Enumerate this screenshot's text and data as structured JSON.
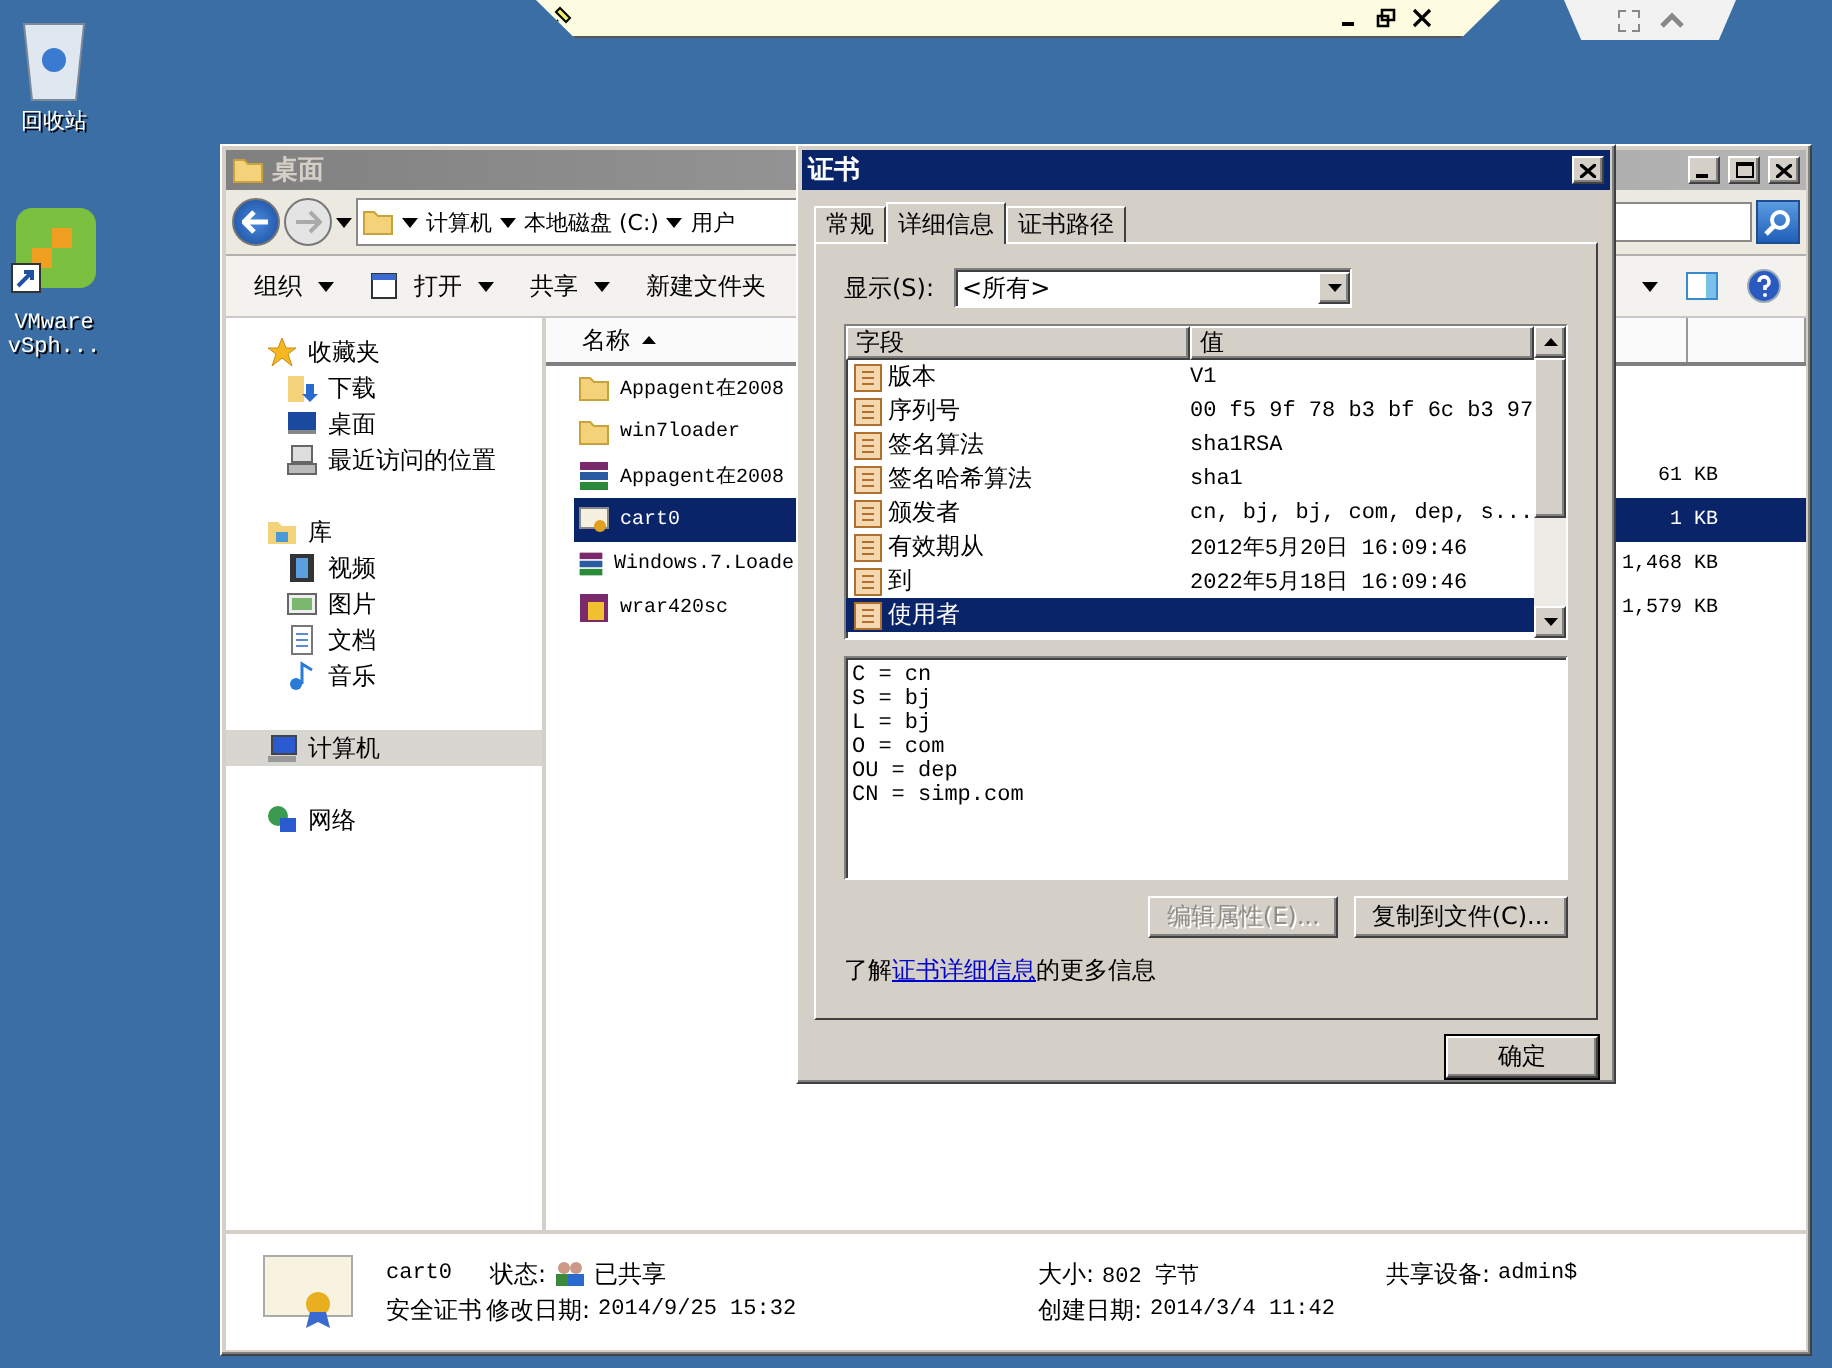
{
  "desktop_icons": [
    {
      "kind": "recycle-bin",
      "label_lines": [
        "回收站"
      ]
    },
    {
      "kind": "shortcut",
      "label_lines": [
        "VMware",
        "vSph..."
      ]
    }
  ],
  "explorer": {
    "title": "桌面",
    "address": [
      "计算机",
      "本地磁盘 (C:)",
      "用户"
    ],
    "toolbar": [
      {
        "label": "组织",
        "kind": "menu"
      },
      {
        "label": "打开",
        "kind": "open"
      },
      {
        "label": "共享",
        "kind": "menu"
      },
      {
        "label": "新建文件夹",
        "kind": "plain"
      }
    ],
    "nav": [
      {
        "label": "收藏夹",
        "kind": "star",
        "selected": false,
        "children": [
          {
            "label": "下载",
            "kind": "download",
            "selected": false
          },
          {
            "label": "桌面",
            "kind": "desktop",
            "selected": false
          },
          {
            "label": "最近访问的位置",
            "kind": "recent",
            "selected": false
          }
        ]
      },
      {
        "label": "库",
        "kind": "library",
        "selected": false,
        "children": [
          {
            "label": "视频",
            "kind": "video",
            "selected": false
          },
          {
            "label": "图片",
            "kind": "picture",
            "selected": false
          },
          {
            "label": "文档",
            "kind": "document",
            "selected": false
          },
          {
            "label": "音乐",
            "kind": "music",
            "selected": false
          }
        ]
      },
      {
        "label": "计算机",
        "kind": "computer",
        "selected": true
      },
      {
        "label": "网络",
        "kind": "network",
        "selected": false
      }
    ],
    "name_column": "名称",
    "files": [
      {
        "name": "Appagent在2008",
        "kind": "folder",
        "selected": false
      },
      {
        "name": "win7loader",
        "kind": "folder",
        "selected": false
      },
      {
        "name": "Appagent在2008",
        "kind": "archive",
        "size": "61 KB",
        "selected": false
      },
      {
        "name": "cart0",
        "kind": "certificate",
        "size": "1 KB",
        "selected": true
      },
      {
        "name": "Windows.7.Loade",
        "kind": "archive",
        "size": "1,468 KB",
        "selected": false
      },
      {
        "name": "wrar420sc",
        "kind": "installer",
        "size": "1,579 KB",
        "selected": false
      }
    ],
    "details": {
      "name": "cart0",
      "type": "安全证书",
      "props": [
        {
          "label": "状态:",
          "value": "已共享",
          "kind": "shared"
        },
        {
          "label": "大小:",
          "value": "802 字节"
        },
        {
          "label": "共享设备:",
          "value": "admin$"
        },
        {
          "label": "修改日期:",
          "value": "2014/9/25 15:32"
        },
        {
          "label": "创建日期:",
          "value": "2014/3/4 11:42"
        }
      ]
    }
  },
  "dialog": {
    "title": "证书",
    "tabs": [
      {
        "label": "常规",
        "selected": false
      },
      {
        "label": "详细信息",
        "selected": true
      },
      {
        "label": "证书路径",
        "selected": false
      }
    ],
    "show_label": "显示(S):",
    "show_value": "<所有>",
    "columns": [
      "字段",
      "值"
    ],
    "fields": [
      {
        "name": "版本",
        "value": "V1",
        "selected": false
      },
      {
        "name": "序列号",
        "value": "00 f5 9f 78 b3 bf 6c b3 97",
        "selected": false
      },
      {
        "name": "签名算法",
        "value": "sha1RSA",
        "selected": false
      },
      {
        "name": "签名哈希算法",
        "value": "sha1",
        "selected": false
      },
      {
        "name": "颁发者",
        "value": "cn, bj, bj, com, dep, s...",
        "selected": false
      },
      {
        "name": "有效期从",
        "value": "2012年5月20日 16:09:46",
        "selected": false
      },
      {
        "name": "到",
        "value": "2022年5月18日 16:09:46",
        "selected": false
      },
      {
        "name": "使用者",
        "selected": true
      }
    ],
    "detail_lines": [
      "C = cn",
      "S = bj",
      "L = bj",
      "O = com",
      "OU = dep",
      "CN = simp.com"
    ],
    "buttons": [
      {
        "label": "编辑属性(E)...",
        "disabled": true
      },
      {
        "label": "复制到文件(C)...",
        "disabled": false
      }
    ],
    "info_prefix": "了解",
    "info_link": "证书详细信息",
    "info_suffix": "的更多信息",
    "ok": "确定"
  }
}
